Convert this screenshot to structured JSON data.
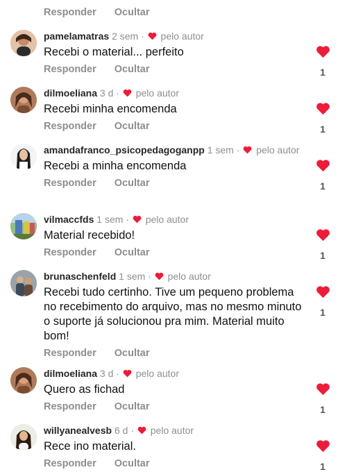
{
  "top_actions": {
    "reply": "Responder",
    "hide": "Ocultar"
  },
  "colors": {
    "heart": "#ed1c39",
    "muted": "#8e8e8e",
    "username": "#262626"
  },
  "comments": [
    {
      "username": "pamelamatras",
      "time": "2 sem",
      "sep": "·",
      "liked_by": "pelo autor",
      "text": "Recebi o material... perfeito",
      "reply": "Responder",
      "hide": "Ocultar",
      "likes": "1",
      "avatar_icon": "avatar-photo"
    },
    {
      "username": "dilmoeliana",
      "time": "3 d",
      "sep": "·",
      "liked_by": "pelo autor",
      "text": "Recebi minha encomenda",
      "reply": "Responder",
      "hide": "Ocultar",
      "likes": "1",
      "avatar_icon": "avatar-photo"
    },
    {
      "username": "amandafranco_psicopedagoganpp",
      "time": "1 sem",
      "sep": "·",
      "liked_by": "pelo autor",
      "text": "Recebi a minha encomenda",
      "reply": "Responder",
      "hide": "Ocultar",
      "likes": "1",
      "avatar_icon": "avatar-photo"
    },
    {
      "username": "vilmaccfds",
      "time": "1 sem",
      "sep": "·",
      "liked_by": "pelo autor",
      "text": "Material recebido!",
      "reply": "Responder",
      "hide": "Ocultar",
      "likes": "1",
      "avatar_icon": "avatar-photo"
    },
    {
      "username": "brunaschenfeld",
      "time": "1 sem",
      "sep": "·",
      "liked_by": "pelo autor",
      "text": "Recebi tudo certinho. Tive um pequeno problema no recebimento do arquivo, mas no mesmo minuto o suporte já solucionou pra mim. Material muito bom!",
      "reply": "Responder",
      "hide": "Ocultar",
      "likes": "1",
      "avatar_icon": "avatar-photo"
    },
    {
      "username": "dilmoeliana",
      "time": "3 d",
      "sep": "·",
      "liked_by": "pelo autor",
      "text": "Quero as fichad",
      "reply": "Responder",
      "hide": "Ocultar",
      "likes": "1",
      "avatar_icon": "avatar-photo"
    },
    {
      "username": "willyanealvesb",
      "time": "6 d",
      "sep": "·",
      "liked_by": "pelo autor",
      "text": "Rece ino material.",
      "reply": "Responder",
      "hide": "Ocultar",
      "likes": "1",
      "avatar_icon": "avatar-photo"
    }
  ]
}
